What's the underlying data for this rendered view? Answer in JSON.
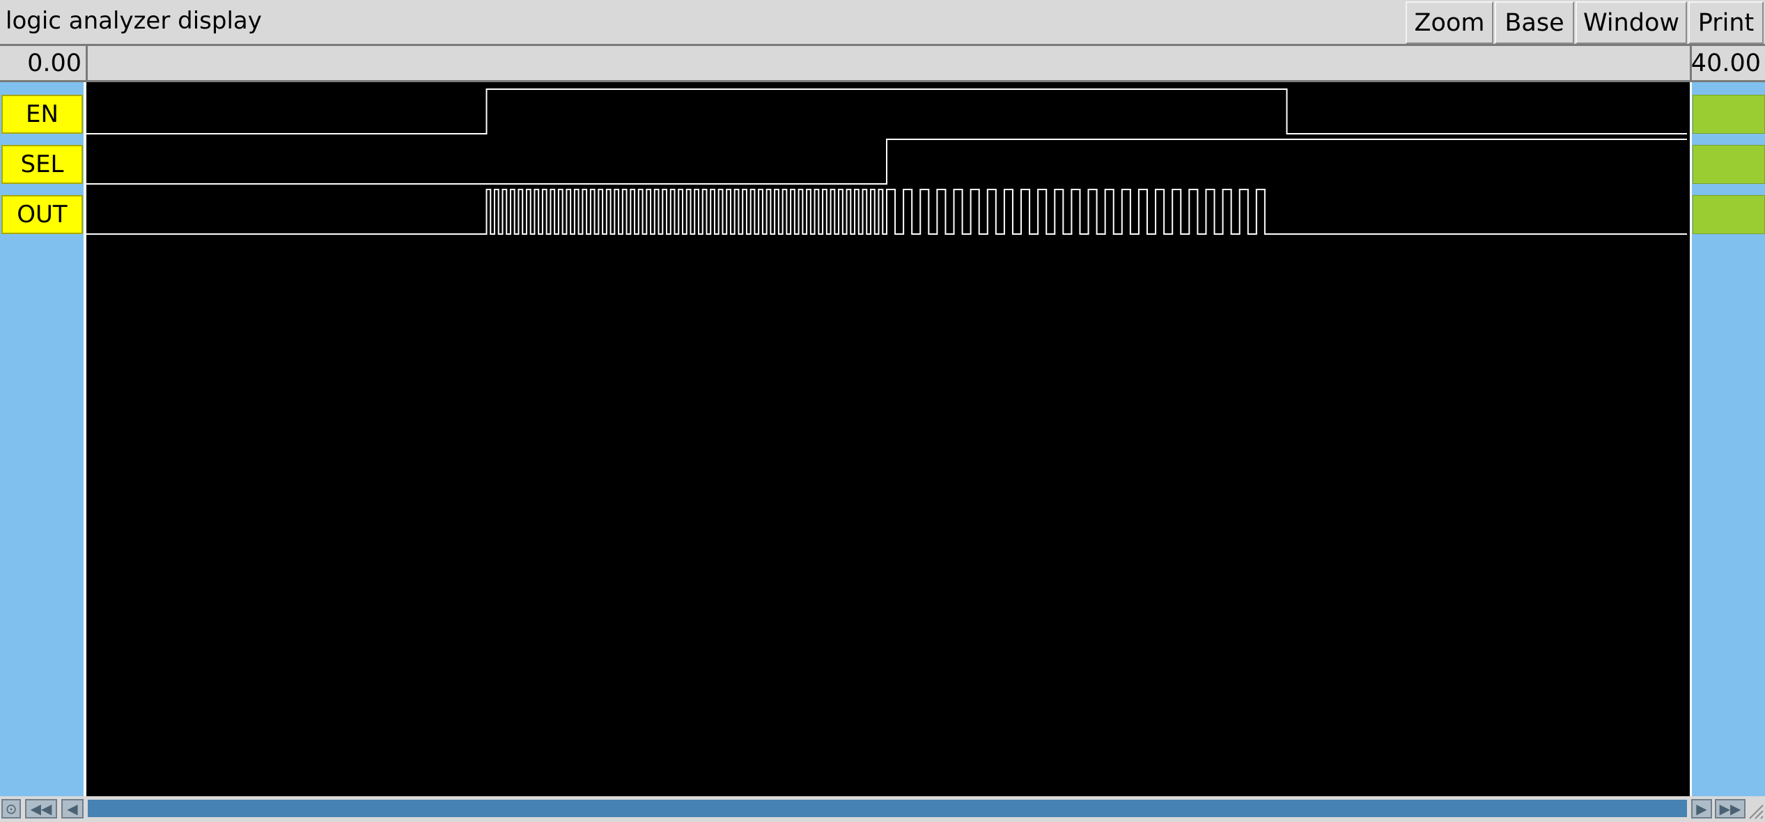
{
  "window": {
    "title": "logic analyzer display"
  },
  "menu": [
    "Zoom",
    "Base",
    "Window",
    "Print"
  ],
  "time": {
    "start": "0.00",
    "end": "40.00"
  },
  "signals": [
    {
      "name": "EN"
    },
    {
      "name": "SEL"
    },
    {
      "name": "OUT"
    }
  ],
  "waveforms": {
    "time_range": [
      0,
      40
    ],
    "EN": [
      [
        0,
        0
      ],
      [
        10,
        1
      ],
      [
        30,
        0
      ]
    ],
    "SEL": [
      [
        0,
        0
      ],
      [
        20,
        1
      ]
    ],
    "OUT": {
      "initial": 0,
      "segments": [
        {
          "start": 10,
          "end": 20,
          "period": 0.2
        },
        {
          "start": 20,
          "end": 30,
          "period": 0.42
        }
      ],
      "final": 0
    }
  },
  "colors": {
    "label_bg": "#ffff00",
    "value_bg": "#9acd32",
    "panel_bg": "#80c0ef",
    "wave_bg": "#000000",
    "wave_line": "#ffffff",
    "scroll_thumb": "#4682b4"
  },
  "icons": [
    "circle-button-icon",
    "double-left-arrow-icon",
    "left-arrow-icon",
    "right-arrow-icon",
    "double-right-arrow-icon",
    "resize-grip-icon"
  ]
}
